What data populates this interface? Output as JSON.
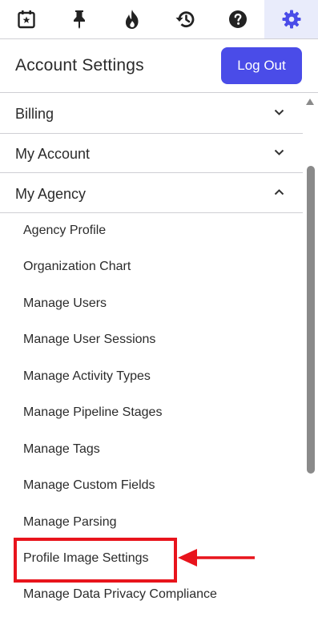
{
  "iconbar": {
    "tabs": [
      {
        "icon": "calendar-star-icon"
      },
      {
        "icon": "pin-icon"
      },
      {
        "icon": "fire-icon"
      },
      {
        "icon": "history-icon"
      },
      {
        "icon": "help-icon"
      },
      {
        "icon": "gear-icon",
        "active": true
      }
    ],
    "active_color": "#4a4ce8"
  },
  "header": {
    "title": "Account Settings",
    "logout_label": "Log Out"
  },
  "sections": [
    {
      "label": "Billing",
      "expanded": false
    },
    {
      "label": "My Account",
      "expanded": false
    },
    {
      "label": "My Agency",
      "expanded": true
    }
  ],
  "agency_items": [
    "Agency Profile",
    "Organization Chart",
    "Manage Users",
    "Manage User Sessions",
    "Manage Activity Types",
    "Manage Pipeline Stages",
    "Manage Tags",
    "Manage Custom Fields",
    "Manage Parsing",
    "Profile Image Settings",
    "Manage Data Privacy Compliance"
  ],
  "annotation": {
    "highlighted_item": "Profile Image Settings",
    "color": "#e8141c"
  }
}
